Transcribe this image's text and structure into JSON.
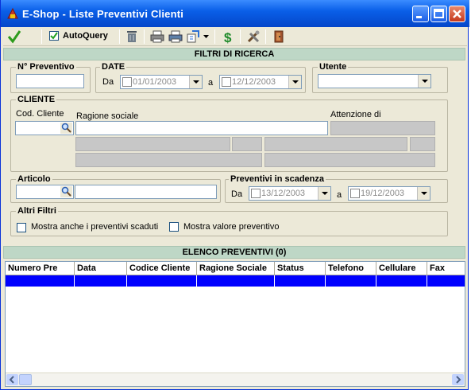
{
  "window": {
    "title": "E-Shop  - Liste Preventivi Clienti"
  },
  "toolbar": {
    "autoquery_label": "AutoQuery",
    "autoquery_checked": true
  },
  "filters": {
    "header": "FILTRI DI RICERCA",
    "num_preventivo": {
      "legend": "N° Preventivo",
      "value": ""
    },
    "date": {
      "legend": "DATE",
      "from_label": "Da",
      "from_value": "01/01/2003",
      "to_label": "a",
      "to_value": "12/12/2003"
    },
    "utente": {
      "legend": "Utente",
      "value": ""
    },
    "cliente": {
      "legend": "CLIENTE",
      "cod_label": "Cod. Cliente",
      "ragione_label": "Ragione sociale",
      "attenzione_label": "Attenzione di"
    },
    "articolo": {
      "legend": "Articolo"
    },
    "scadenza": {
      "legend": "Preventivi in scadenza",
      "from_label": "Da",
      "from_value": "13/12/2003",
      "to_label": "a",
      "to_value": "19/12/2003"
    },
    "altri": {
      "legend": "Altri Filtri",
      "scaduti_label": "Mostra anche i preventivi scaduti",
      "valore_label": "Mostra valore preventivo"
    }
  },
  "elenco": {
    "header": "ELENCO PREVENTIVI (0)",
    "columns": [
      "Numero Pre",
      "Data",
      "Codice Cliente",
      "Ragione Sociale",
      "Status",
      "Telefono",
      "Cellulare",
      "Fax"
    ]
  },
  "colors": {
    "title_bar": "#0a5fe8",
    "section_header": "#bed7c6",
    "selection": "#0000ff"
  }
}
